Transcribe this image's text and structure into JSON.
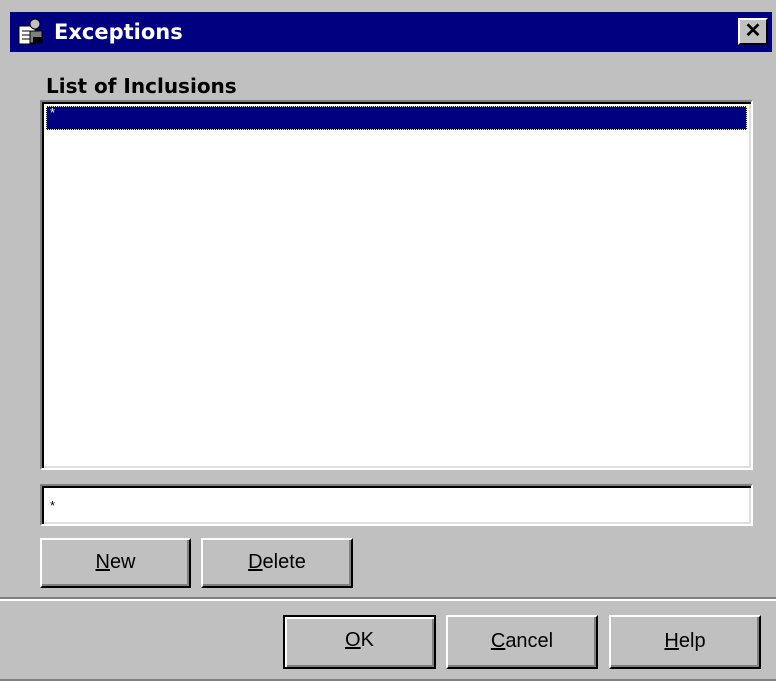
{
  "window": {
    "title": "Exceptions",
    "title_icon": "exceptions-app-icon",
    "close_icon": "close-icon",
    "close_glyph": "✕"
  },
  "inclusions": {
    "label": "List of Inclusions",
    "items": [
      {
        "text": "*",
        "selected": true
      }
    ]
  },
  "entry": {
    "value": "*"
  },
  "buttons": {
    "new": {
      "accel": "N",
      "rest": "ew"
    },
    "delete": {
      "accel": "D",
      "rest": "elete"
    },
    "ok": {
      "accel": "O",
      "rest": "K"
    },
    "cancel": {
      "accel": "C",
      "rest": "ancel"
    },
    "help": {
      "accel": "H",
      "rest": "elp"
    }
  },
  "colors": {
    "titlebar": "#000080",
    "face": "#c0c0c0",
    "selection": "#000080"
  }
}
